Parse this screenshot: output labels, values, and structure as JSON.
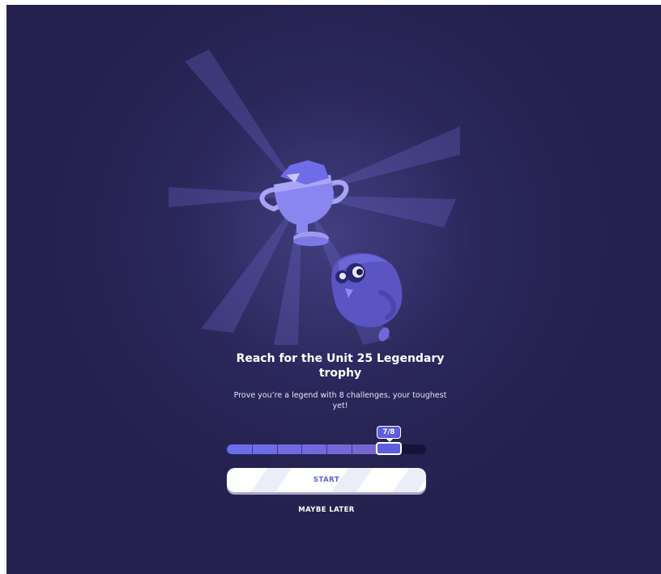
{
  "trophy": {
    "unit_number": "25"
  },
  "modal": {
    "title": "Reach for the Unit 25 Legendary trophy",
    "subtitle": "Prove you’re a legend with 8 challenges, your toughest yet!"
  },
  "progress": {
    "badge": "7/8",
    "completed": 7,
    "total": 8
  },
  "actions": {
    "start_label": "START",
    "later_label": "MAYBE LATER"
  },
  "colors": {
    "background": "#24214e",
    "accent": "#5b5ee0",
    "trophy": "#8a86f0"
  }
}
